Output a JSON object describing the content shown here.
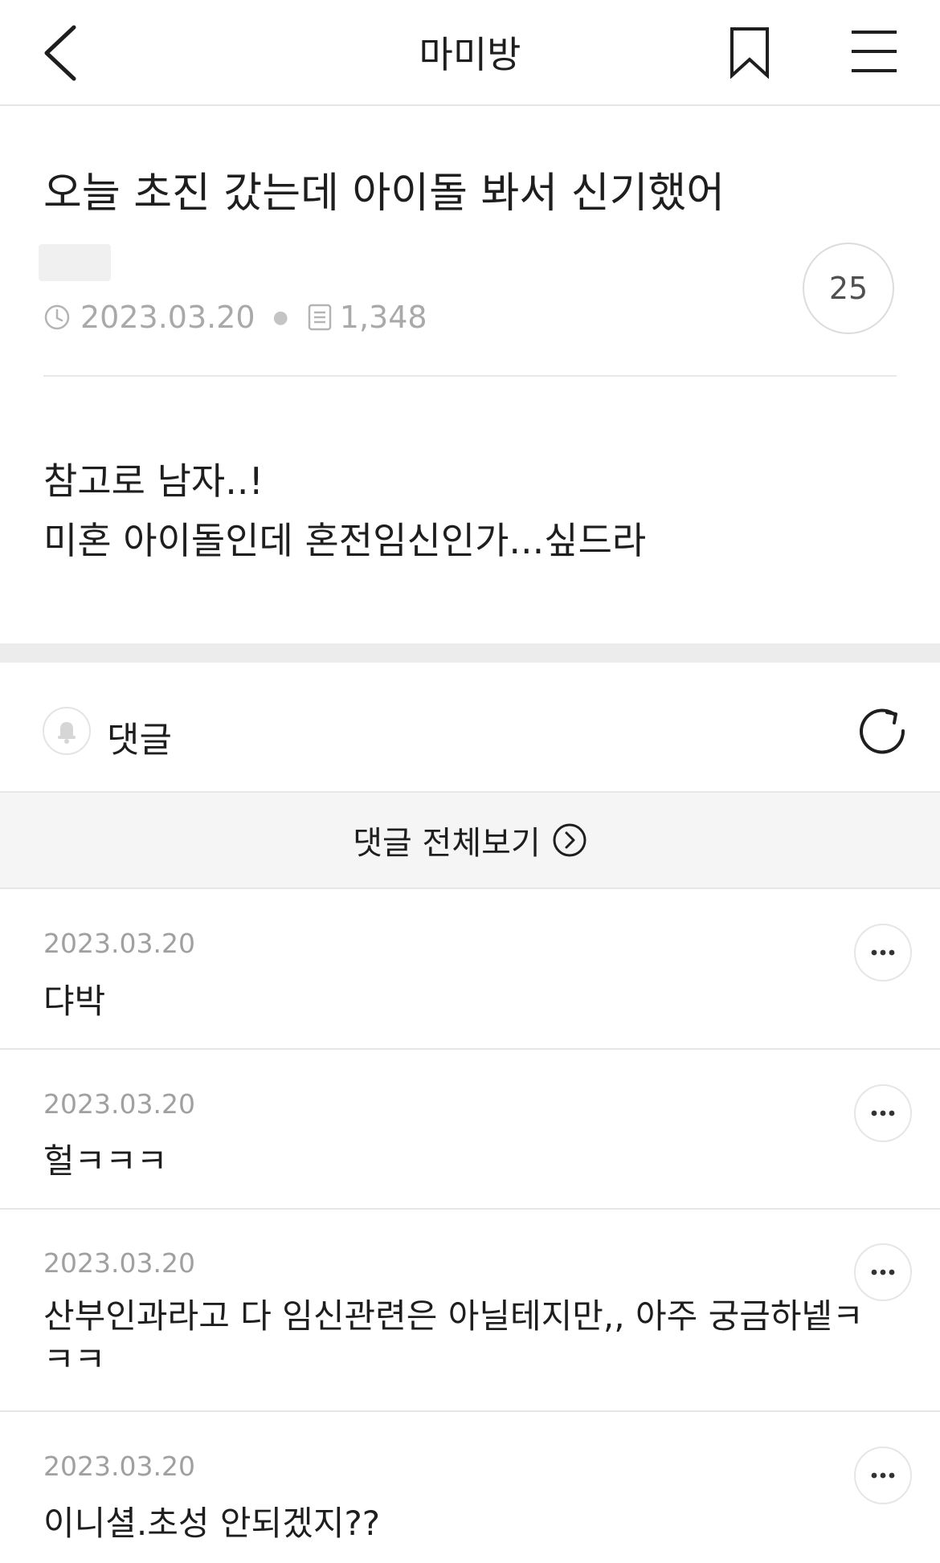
{
  "header": {
    "title": "마미방",
    "back_icon": "chevron-left-icon",
    "bookmark_icon": "bookmark-icon",
    "menu_icon": "hamburger-menu-icon"
  },
  "post": {
    "title": "오늘 초진 갔는데 아이돌 봐서 신기했어",
    "date": "2023.03.20",
    "views": "1,348",
    "comment_count": "25",
    "body_line1": "참고로 남자..!",
    "body_line2": "미혼 아이돌인데 혼전임신인가...싶드라"
  },
  "comments_section": {
    "label": "댓글",
    "view_all_label": "댓글 전체보기",
    "items": [
      {
        "date": "2023.03.20",
        "text": "댜박"
      },
      {
        "date": "2023.03.20",
        "text": "헐ㅋㅋㅋ"
      },
      {
        "date": "2023.03.20",
        "text_line1": "산부인과라고 다 임신관련은 아닐테지만,, 아주 궁금하넽ㅋ",
        "text_line2": "ㅋㅋ"
      },
      {
        "date": "2023.03.20",
        "text": "이니셜.초성 안되겠지??"
      }
    ]
  },
  "colors": {
    "text": "#1e1e1e",
    "muted": "#a9a9a9",
    "divider": "#e6e6e6",
    "section_separator": "#ececec"
  }
}
